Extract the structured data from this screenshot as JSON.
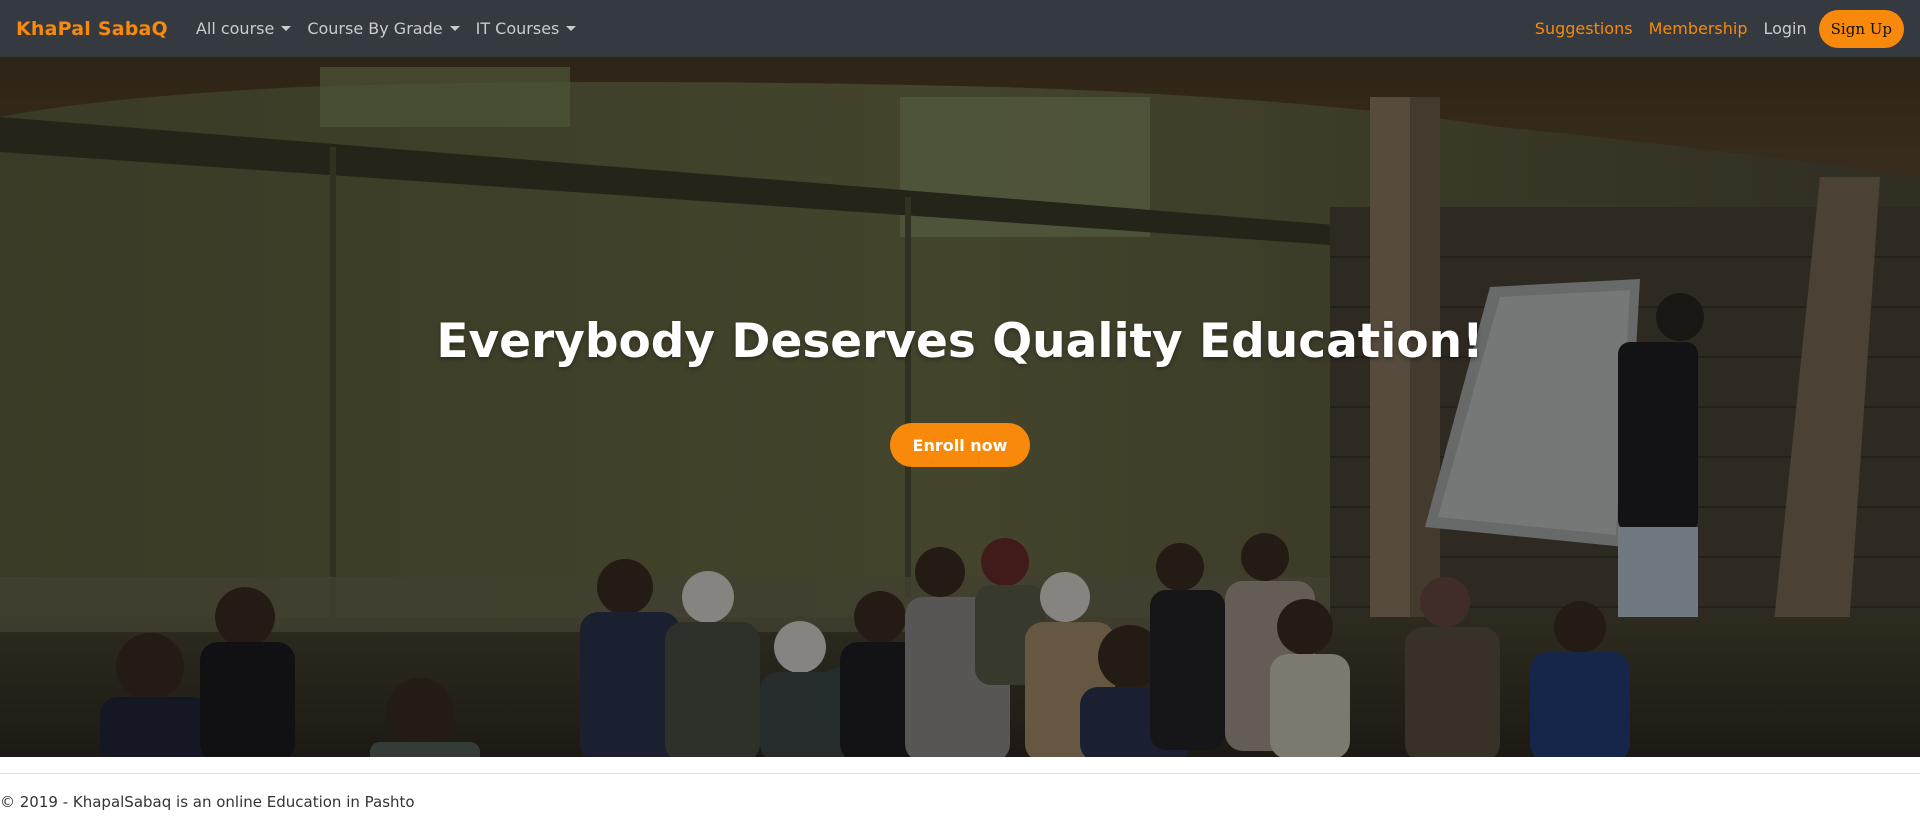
{
  "navbar": {
    "brand": "KhaPal SabaQ",
    "dropdowns": [
      {
        "label": "All course"
      },
      {
        "label": "Course By Grade"
      },
      {
        "label": "IT Courses"
      }
    ],
    "right_links": {
      "suggestions": "Suggestions",
      "membership": "Membership",
      "login": "Login",
      "signup": "Sign Up"
    }
  },
  "hero": {
    "title": "Everybody Deserves Quality Education!",
    "cta": "Enroll now"
  },
  "footer": {
    "text": "© 2019 - KhapalSabaq is an online Education in Pashto"
  },
  "colors": {
    "navbar_bg": "#343a40",
    "accent": "#f8890b",
    "nav_text": "#c9cccf"
  }
}
